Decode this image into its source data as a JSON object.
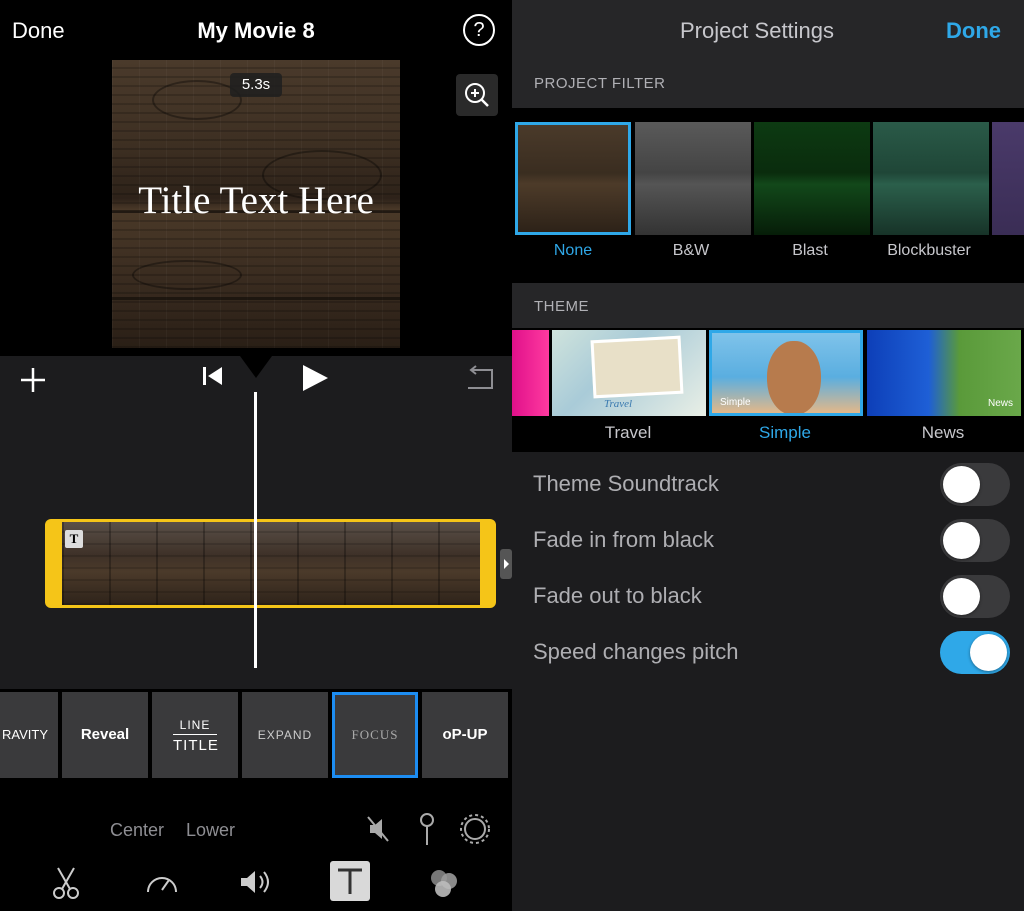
{
  "editor": {
    "done_label": "Done",
    "movie_title": "My Movie 8",
    "help_label": "?",
    "clip_duration": "5.3s",
    "title_text": "Title Text Here",
    "clip_badge": "T",
    "title_styles": [
      {
        "label": "RAVITY"
      },
      {
        "label": "Reveal"
      },
      {
        "label": "LINE",
        "label2": "TITLE"
      },
      {
        "label": "EXPAND"
      },
      {
        "label": "FOCUS",
        "selected": true
      },
      {
        "label": "oP-UP"
      }
    ],
    "positions": {
      "center": "Center",
      "lower": "Lower"
    },
    "clip_accent": "#f5c518",
    "selection_color": "#1d8df2"
  },
  "settings": {
    "title": "Project Settings",
    "done_label": "Done",
    "project_filter_header": "PROJECT FILTER",
    "filters": [
      {
        "label": "None",
        "selected": true
      },
      {
        "label": "B&W"
      },
      {
        "label": "Blast"
      },
      {
        "label": "Blockbuster"
      }
    ],
    "theme_header": "THEME",
    "themes": [
      {
        "label": "Travel",
        "badge": "Travel"
      },
      {
        "label": "Simple",
        "selected": true,
        "badge": "Simple"
      },
      {
        "label": "News",
        "badge": "News"
      }
    ],
    "toggles": [
      {
        "label": "Theme Soundtrack",
        "on": false
      },
      {
        "label": "Fade in from black",
        "on": false
      },
      {
        "label": "Fade out to black",
        "on": false
      },
      {
        "label": "Speed changes pitch",
        "on": true
      }
    ],
    "accent_color": "#2fa8e8"
  }
}
